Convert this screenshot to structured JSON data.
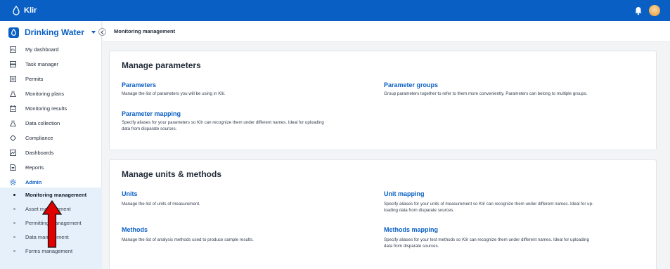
{
  "app": {
    "name": "Klir"
  },
  "workspace": {
    "label": "Drinking Water"
  },
  "breadcrumb": "Monitoring management",
  "sidebar": {
    "items": [
      {
        "label": "My dashboard",
        "icon": "dashboard-icon"
      },
      {
        "label": "Task manager",
        "icon": "task-icon"
      },
      {
        "label": "Permits",
        "icon": "permit-icon"
      },
      {
        "label": "Monitoring plans",
        "icon": "flask-icon"
      },
      {
        "label": "Monitoring results",
        "icon": "results-icon"
      },
      {
        "label": "Data collection",
        "icon": "flask-icon"
      },
      {
        "label": "Compliance",
        "icon": "shield-icon"
      },
      {
        "label": "Dashboards",
        "icon": "chart-icon"
      },
      {
        "label": "Reports",
        "icon": "report-icon"
      },
      {
        "label": "Admin",
        "icon": "gear-icon"
      }
    ],
    "admin_sub": [
      {
        "label": "Monitoring management",
        "active": true
      },
      {
        "label": "Asset management"
      },
      {
        "label": "Permitting management"
      },
      {
        "label": "Data management"
      },
      {
        "label": "Forms management"
      }
    ]
  },
  "parameters_card": {
    "title": "Manage parameters",
    "parameters": {
      "title": "Parameters",
      "desc": "Manage the list of parameters you will be using in Klir."
    },
    "groups": {
      "title": "Parameter groups",
      "desc": "Group parameters together to refer to them more conveniently. Parameters can belong to multiple groups."
    },
    "mapping": {
      "title": "Parameter mapping",
      "desc1": "Specify aliases for your parameters so Klir can recognize them under different names. Ideal for uploading",
      "desc2": "data from disparate sources."
    }
  },
  "units_card": {
    "title": "Manage units & methods",
    "units": {
      "title": "Units",
      "desc": "Manage the list of units of measurement."
    },
    "unit_mapping": {
      "title": "Unit mapping",
      "desc1": "Specify aliases for your units of measurement so Klir can recognize them under different names. Ideal for up-",
      "desc2": "loading data from disparate sources."
    },
    "methods": {
      "title": "Methods",
      "desc": "Manage the list of analysis methods used to produce sample results."
    },
    "methods_mapping": {
      "title": "Methods mapping",
      "desc1": "Specify aliases for your test methods so Klir can recognize them under different names. Ideal for uploading",
      "desc2": "data from disparate sources."
    }
  },
  "colors": {
    "brand": "#0a5fc4",
    "annotation_arrow": "#e00000"
  }
}
